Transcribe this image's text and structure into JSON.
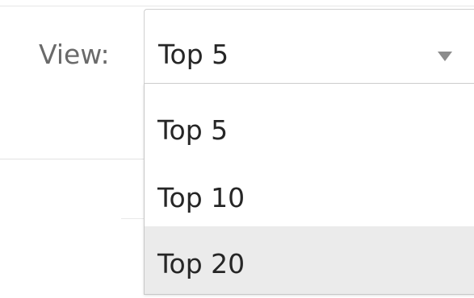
{
  "filter": {
    "label": "View:",
    "selected_value": "Top 5"
  },
  "dropdown": {
    "options": [
      {
        "label": "Top 5"
      },
      {
        "label": "Top 10"
      },
      {
        "label": "Top 20",
        "highlighted": true
      }
    ]
  },
  "colors": {
    "highlight_background": "#ebebeb",
    "text": "#262626",
    "label_text": "#6a6a6a"
  }
}
